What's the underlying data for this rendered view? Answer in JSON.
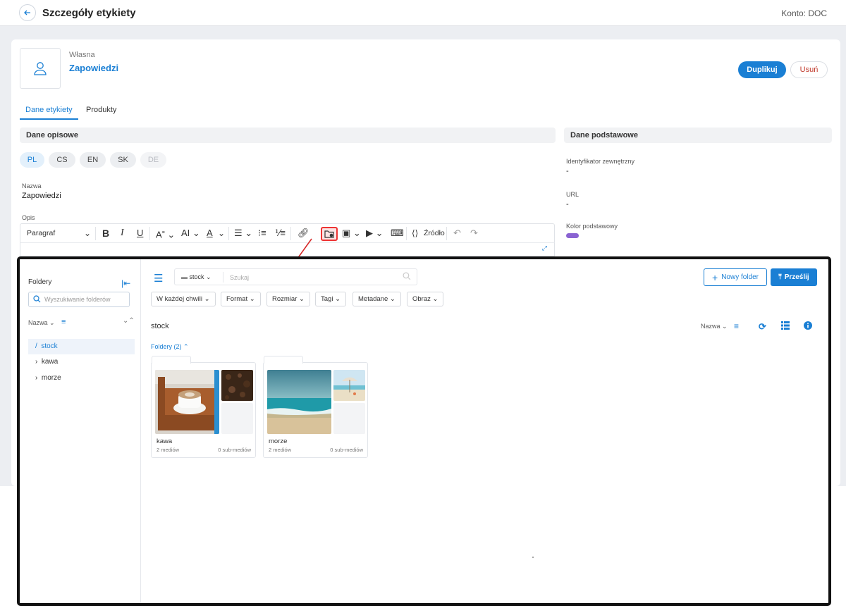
{
  "header": {
    "title": "Szczegóły etykiety",
    "account": "Konto: DOC"
  },
  "label": {
    "owner": "Własna",
    "name": "Zapowiedzi"
  },
  "actions": {
    "duplicate": "Duplikuj",
    "delete": "Usuń"
  },
  "tabs": [
    {
      "label": "Dane etykiety",
      "active": true
    },
    {
      "label": "Produkty",
      "active": false
    }
  ],
  "sections": {
    "descriptive": "Dane opisowe",
    "basic": "Dane podstawowe"
  },
  "languages": [
    {
      "code": "PL",
      "state": "active"
    },
    {
      "code": "CS",
      "state": "normal"
    },
    {
      "code": "EN",
      "state": "normal"
    },
    {
      "code": "SK",
      "state": "normal"
    },
    {
      "code": "DE",
      "state": "disabled"
    }
  ],
  "fields": {
    "name_label": "Nazwa",
    "name_value": "Zapowiedzi",
    "description_label": "Opis",
    "external_id_label": "Identyfikator zewnętrzny",
    "external_id_value": "-",
    "url_label": "URL",
    "url_value": "-",
    "color_label": "Kolor podstawowy",
    "color_value": "#8a63d2"
  },
  "editor": {
    "paragraph": "Paragraf",
    "source": "Źródło"
  },
  "media": {
    "sidebar": {
      "title": "Foldery",
      "search_placeholder": "Wyszukiwanie folderów",
      "sort_label": "Nazwa",
      "tree": [
        {
          "label": "stock",
          "prefix": "/",
          "active": true
        },
        {
          "label": "kawa",
          "prefix": "›",
          "active": false
        },
        {
          "label": "morze",
          "prefix": "›",
          "active": false
        }
      ]
    },
    "search": {
      "folder": "stock",
      "placeholder": "Szukaj"
    },
    "buttons": {
      "new_folder": "Nowy folder",
      "upload": "Prześlij"
    },
    "filters": [
      "W każdej chwili",
      "Format",
      "Rozmiar",
      "Tagi",
      "Metadane",
      "Obraz"
    ],
    "breadcrumb": "stock",
    "sort_label": "Nazwa",
    "folders_heading": "Foldery (2)",
    "folders": [
      {
        "name": "kawa",
        "media_count": "2 mediów",
        "sub_count": "0 sub-mediów"
      },
      {
        "name": "morze",
        "media_count": "2 mediów",
        "sub_count": "0 sub-mediów"
      }
    ]
  },
  "colors": {
    "accent": "#1a7fd4",
    "danger": "#c0392b",
    "highlight": "#e33333"
  }
}
